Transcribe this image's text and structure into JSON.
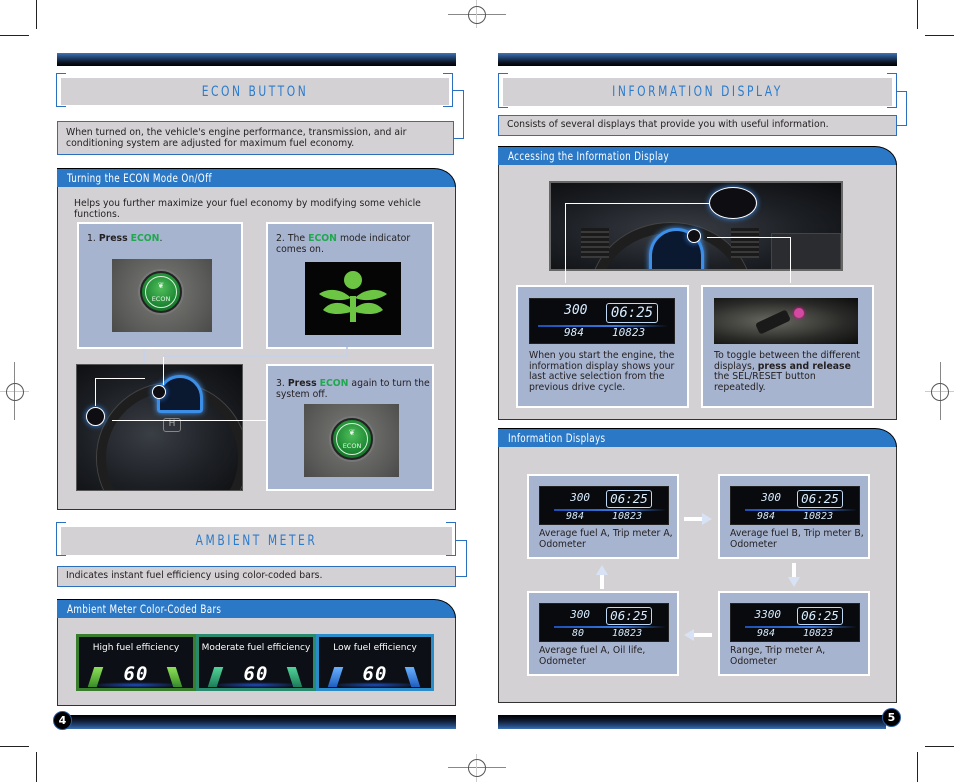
{
  "pages": {
    "left": {
      "page_number": "4",
      "econ": {
        "title": "ECON BUTTON",
        "description": "When turned on, the vehicle's engine performance, transmission, and air conditioning system are adjusted for maximum fuel economy.",
        "section_tab": "Turning the ECON Mode On/Off",
        "intro": "Helps you further maximize your fuel economy by modifying some vehicle functions.",
        "steps": [
          {
            "num": "1.",
            "pre": "Press",
            "keyword": "ECON",
            "post": "."
          },
          {
            "num": "2.",
            "pre": "The",
            "keyword": "ECON",
            "post": "mode indicator comes on."
          },
          {
            "num": "3.",
            "pre": "Press",
            "keyword": "ECON",
            "post": "again to turn the system off."
          }
        ],
        "button_label": "ECON"
      },
      "ambient": {
        "title": "AMBIENT METER",
        "description": "Indicates instant fuel efficiency using color-coded bars.",
        "section_tab": "Ambient Meter Color-Coded Bars",
        "meters": [
          {
            "label": "High fuel efficiency",
            "speed": "60",
            "color": "#3a7d2c",
            "bar_color": "#6fc23a"
          },
          {
            "label": "Moderate fuel efficiency",
            "speed": "60",
            "color": "#2a8a6e",
            "bar_color": "#2fae7c"
          },
          {
            "label": "Low fuel efficiency",
            "speed": "60",
            "color": "#2a8cc8",
            "bar_color": "#3b8fe8"
          }
        ]
      }
    },
    "right": {
      "page_number": "5",
      "info": {
        "title": "INFORMATION DISPLAY",
        "description": "Consists of several displays that provide you with useful information.",
        "access_tab": "Accessing the Information Display",
        "access_cards": [
          {
            "text": "When you start the engine, the information display shows your last active selection from the previous drive cycle.",
            "lcd": {
              "top_left": "300",
              "clock": "06:25",
              "bottom_left": "984",
              "bottom_right": "10823"
            }
          },
          {
            "text_pre": "To toggle between the different displays, ",
            "text_bold": "press and release",
            "text_post": " the SEL/RESET button repeatedly."
          }
        ],
        "displays_tab": "Information Displays",
        "displays": [
          {
            "caption": "Average fuel A, Trip meter A, Odometer",
            "top_left": "300",
            "clock": "06:25",
            "bottom_left": "984",
            "bottom_right": "10823"
          },
          {
            "caption": "Average fuel B, Trip meter B, Odometer",
            "top_left": "300",
            "clock": "06:25",
            "bottom_left": "984",
            "bottom_right": "10823"
          },
          {
            "caption": "Range, Trip meter A, Odometer",
            "top_left": "3300",
            "clock": "06:25",
            "bottom_left": "984",
            "bottom_right": "10823"
          },
          {
            "caption": "Average fuel A, Oil life, Odometer",
            "top_left": "300",
            "clock": "06:25",
            "bottom_left": "80",
            "bottom_right": "10823"
          }
        ]
      }
    }
  },
  "colors": {
    "accent_blue": "#2b78c6",
    "title_blue": "#2b7bcc",
    "econ_green": "#20a84e",
    "panel_gray": "#d3d1d4",
    "card_blue": "#a7b4d0"
  }
}
